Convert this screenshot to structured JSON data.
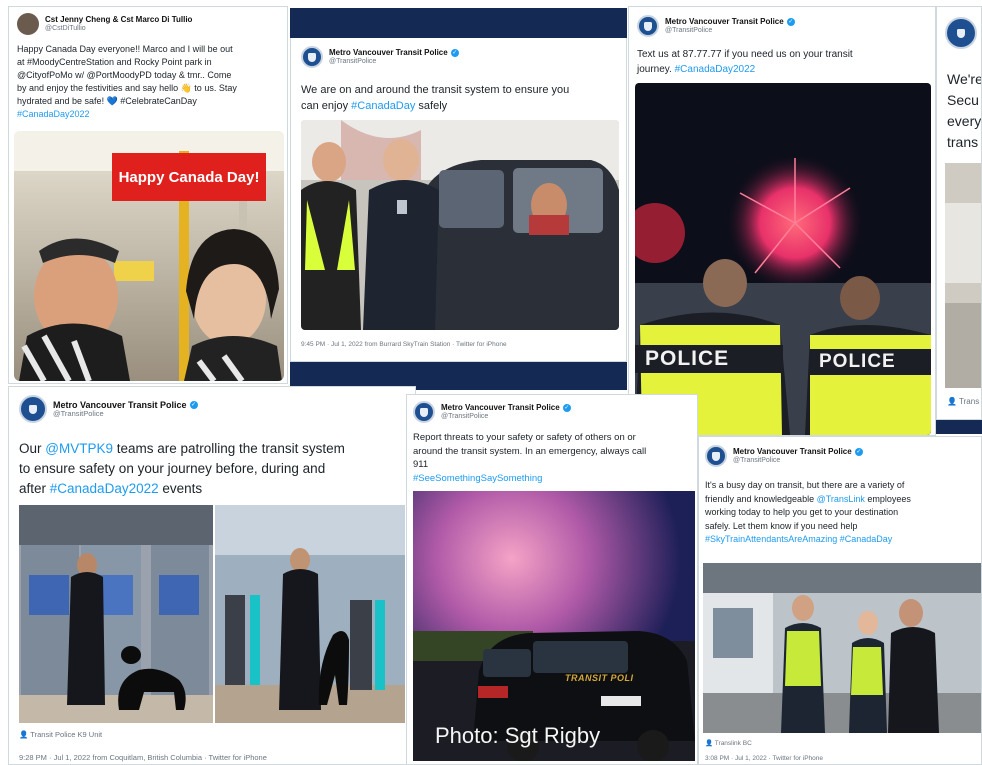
{
  "tweet1": {
    "name": "Cst Jenny Cheng & Cst Marco Di Tullio",
    "handle": "@CstDiTullio",
    "lines": [
      "Happy Canada Day everyone!! Marco and I will be out",
      "at #MoodyCentreStation and Rocky Point park in",
      "@CityofPoMo w/ @PortMoodyPD today & tmr.. Come",
      "by and enjoy the festivities and say hello 👋 to us. Stay",
      "hydrated and be safe! 💙 #CelebrateCanDay",
      "#CanadaDay2022"
    ],
    "photo_caption": "Happy Canada Day!"
  },
  "tweet2": {
    "name": "Metro Vancouver Transit Police",
    "handle": "@TransitPolice",
    "text_a": "We are on and around the transit system to ensure you",
    "text_b": "can enjoy ",
    "hashtag": "#CanadaDay",
    "text_c": " safely",
    "meta": "9:45 PM · Jul 1, 2022 from Burrard SkyTrain Station · Twitter for iPhone"
  },
  "tweet3": {
    "name": "Metro Vancouver Transit Police",
    "handle": "@TransitPolice",
    "text_a": "Text us at 87.77.77 if you need us on your transit",
    "text_b": "journey. ",
    "hashtag": "#CanadaDay2022",
    "vest_left": "POLICE",
    "vest_right": "POLICE"
  },
  "tweet4": {
    "lines": [
      "We're",
      "Secu",
      "every",
      "trans"
    ],
    "footer": "Trans"
  },
  "tweet5": {
    "name": "Metro Vancouver Transit Police",
    "handle": "@TransitPolice",
    "pre": "Our ",
    "mention": "@MVTPK9",
    "line1_rest": " teams are patrolling the transit system",
    "line2": "to ensure safety on your journey before, during and",
    "line3_pre": "after ",
    "line3_tag": "#CanadaDay2022",
    "line3_post": " events",
    "location": "Transit Police K9 Unit",
    "meta": "9:28 PM · Jul 1, 2022 from Coquitlam, British Columbia · Twitter for iPhone"
  },
  "tweet6": {
    "name": "Metro Vancouver Transit Police",
    "handle": "@TransitPolice",
    "lines": [
      "Report threats to your safety or safety of others on or",
      "around the transit system. In an emergency, always call",
      "911"
    ],
    "hashtag": "#SeeSomethingSaySomething",
    "photo_credit": "Photo: Sgt Rigby",
    "car_text": "TRANSIT POLI"
  },
  "tweet7": {
    "name": "Metro Vancouver Transit Police",
    "handle": "@TransitPolice",
    "l1": "It's a busy day on transit, but there are a variety of",
    "l2a": "friendly and knowledgeable ",
    "l2b": "@TransLink",
    "l2c": " employees",
    "l3": "working today to help you get to your destination",
    "l4": "safely. Let them know if you need help",
    "l5a": "#SkyTrainAttendantsAreAmazing",
    "l5b": " #CanadaDay",
    "location": "Translink BC",
    "meta": "3:08 PM · Jul 1, 2022 · Twitter for iPhone"
  },
  "colors": {
    "link": "#1d9bf0",
    "navy": "#142a55",
    "police_blue": "#1d4f91",
    "banner_red": "#e0201c"
  }
}
